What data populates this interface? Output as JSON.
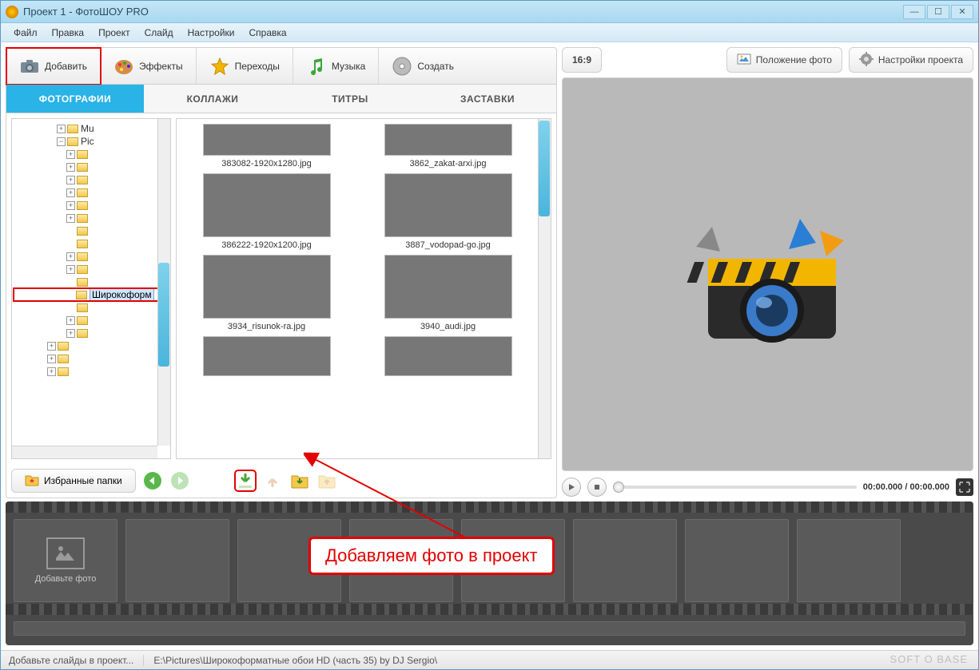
{
  "window": {
    "title": "Проект 1 - ФотоШОУ PRO"
  },
  "menu": [
    "Файл",
    "Правка",
    "Проект",
    "Слайд",
    "Настройки",
    "Справка"
  ],
  "toolbar": [
    {
      "label": "Добавить",
      "icon": "camera-add-icon"
    },
    {
      "label": "Эффекты",
      "icon": "palette-icon"
    },
    {
      "label": "Переходы",
      "icon": "star-icon"
    },
    {
      "label": "Музыка",
      "icon": "music-note-icon"
    },
    {
      "label": "Создать",
      "icon": "disc-icon"
    }
  ],
  "subtabs": [
    "ФОТОГРАФИИ",
    "КОЛЛАЖИ",
    "ТИТРЫ",
    "ЗАСТАВКИ"
  ],
  "tree": {
    "selected": "Широкоформ"
  },
  "thumbs": [
    {
      "caption": "383082-1920x1280.jpg"
    },
    {
      "caption": "3862_zakat-arxi.jpg"
    },
    {
      "caption": "386222-1920x1200.jpg"
    },
    {
      "caption": "3887_vodopad-go.jpg"
    },
    {
      "caption": "3934_risunok-ra.jpg"
    },
    {
      "caption": "3940_audi.jpg"
    },
    {
      "caption": ""
    },
    {
      "caption": ""
    }
  ],
  "fav_button": "Избранные папки",
  "right": {
    "ratio": "16:9",
    "photo_pos": "Положение фото",
    "proj_settings": "Настройки проекта",
    "time": "00:00.000 / 00:00.000"
  },
  "timeline": {
    "add_photo": "Добавьте фото"
  },
  "status": {
    "hint": "Добавьте слайды в проект...",
    "path": "E:\\Pictures\\Широкоформатные обои HD (часть 35) by DJ Sergio\\"
  },
  "callout": "Добавляем фото в проект",
  "watermark": "SOFT O BASE"
}
